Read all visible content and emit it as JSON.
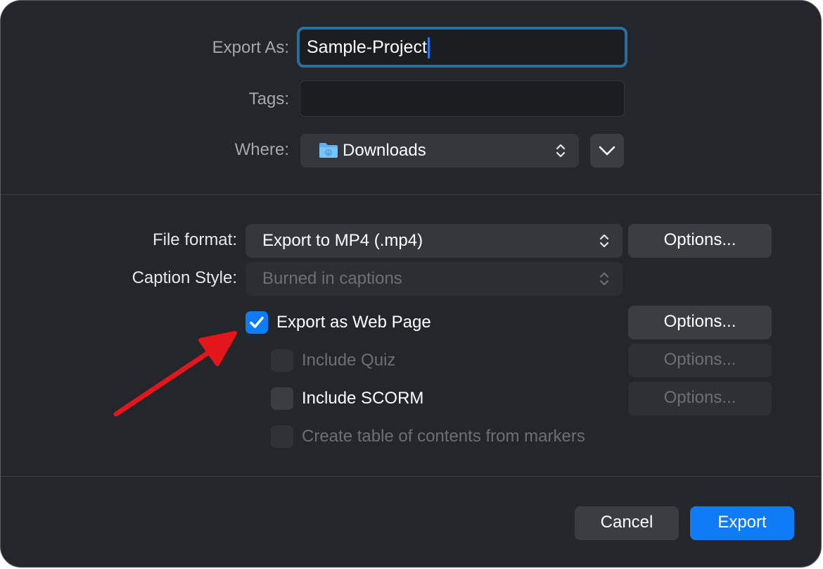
{
  "top": {
    "export_as_label": "Export As:",
    "export_as_value": "Sample-Project",
    "tags_label": "Tags:",
    "tags_value": "",
    "where_label": "Where:",
    "where_value": "Downloads"
  },
  "settings": {
    "file_format_label": "File format:",
    "file_format_value": "Export to MP4 (.mp4)",
    "caption_style_label": "Caption Style:",
    "caption_style_value": "Burned in captions",
    "options_label": "Options...",
    "export_web_page": {
      "label": "Export as Web Page",
      "checked": true
    },
    "include_quiz": {
      "label": "Include Quiz",
      "checked": false,
      "enabled": false
    },
    "include_scorm": {
      "label": "Include SCORM",
      "checked": false,
      "enabled": true
    },
    "create_toc": {
      "label": "Create table of contents from markers",
      "checked": false,
      "enabled": false
    }
  },
  "footer": {
    "cancel_label": "Cancel",
    "export_label": "Export"
  },
  "colors": {
    "dialog_bg": "#23262b",
    "accent": "#0f7bf4",
    "annotation_arrow": "#e3161b"
  }
}
